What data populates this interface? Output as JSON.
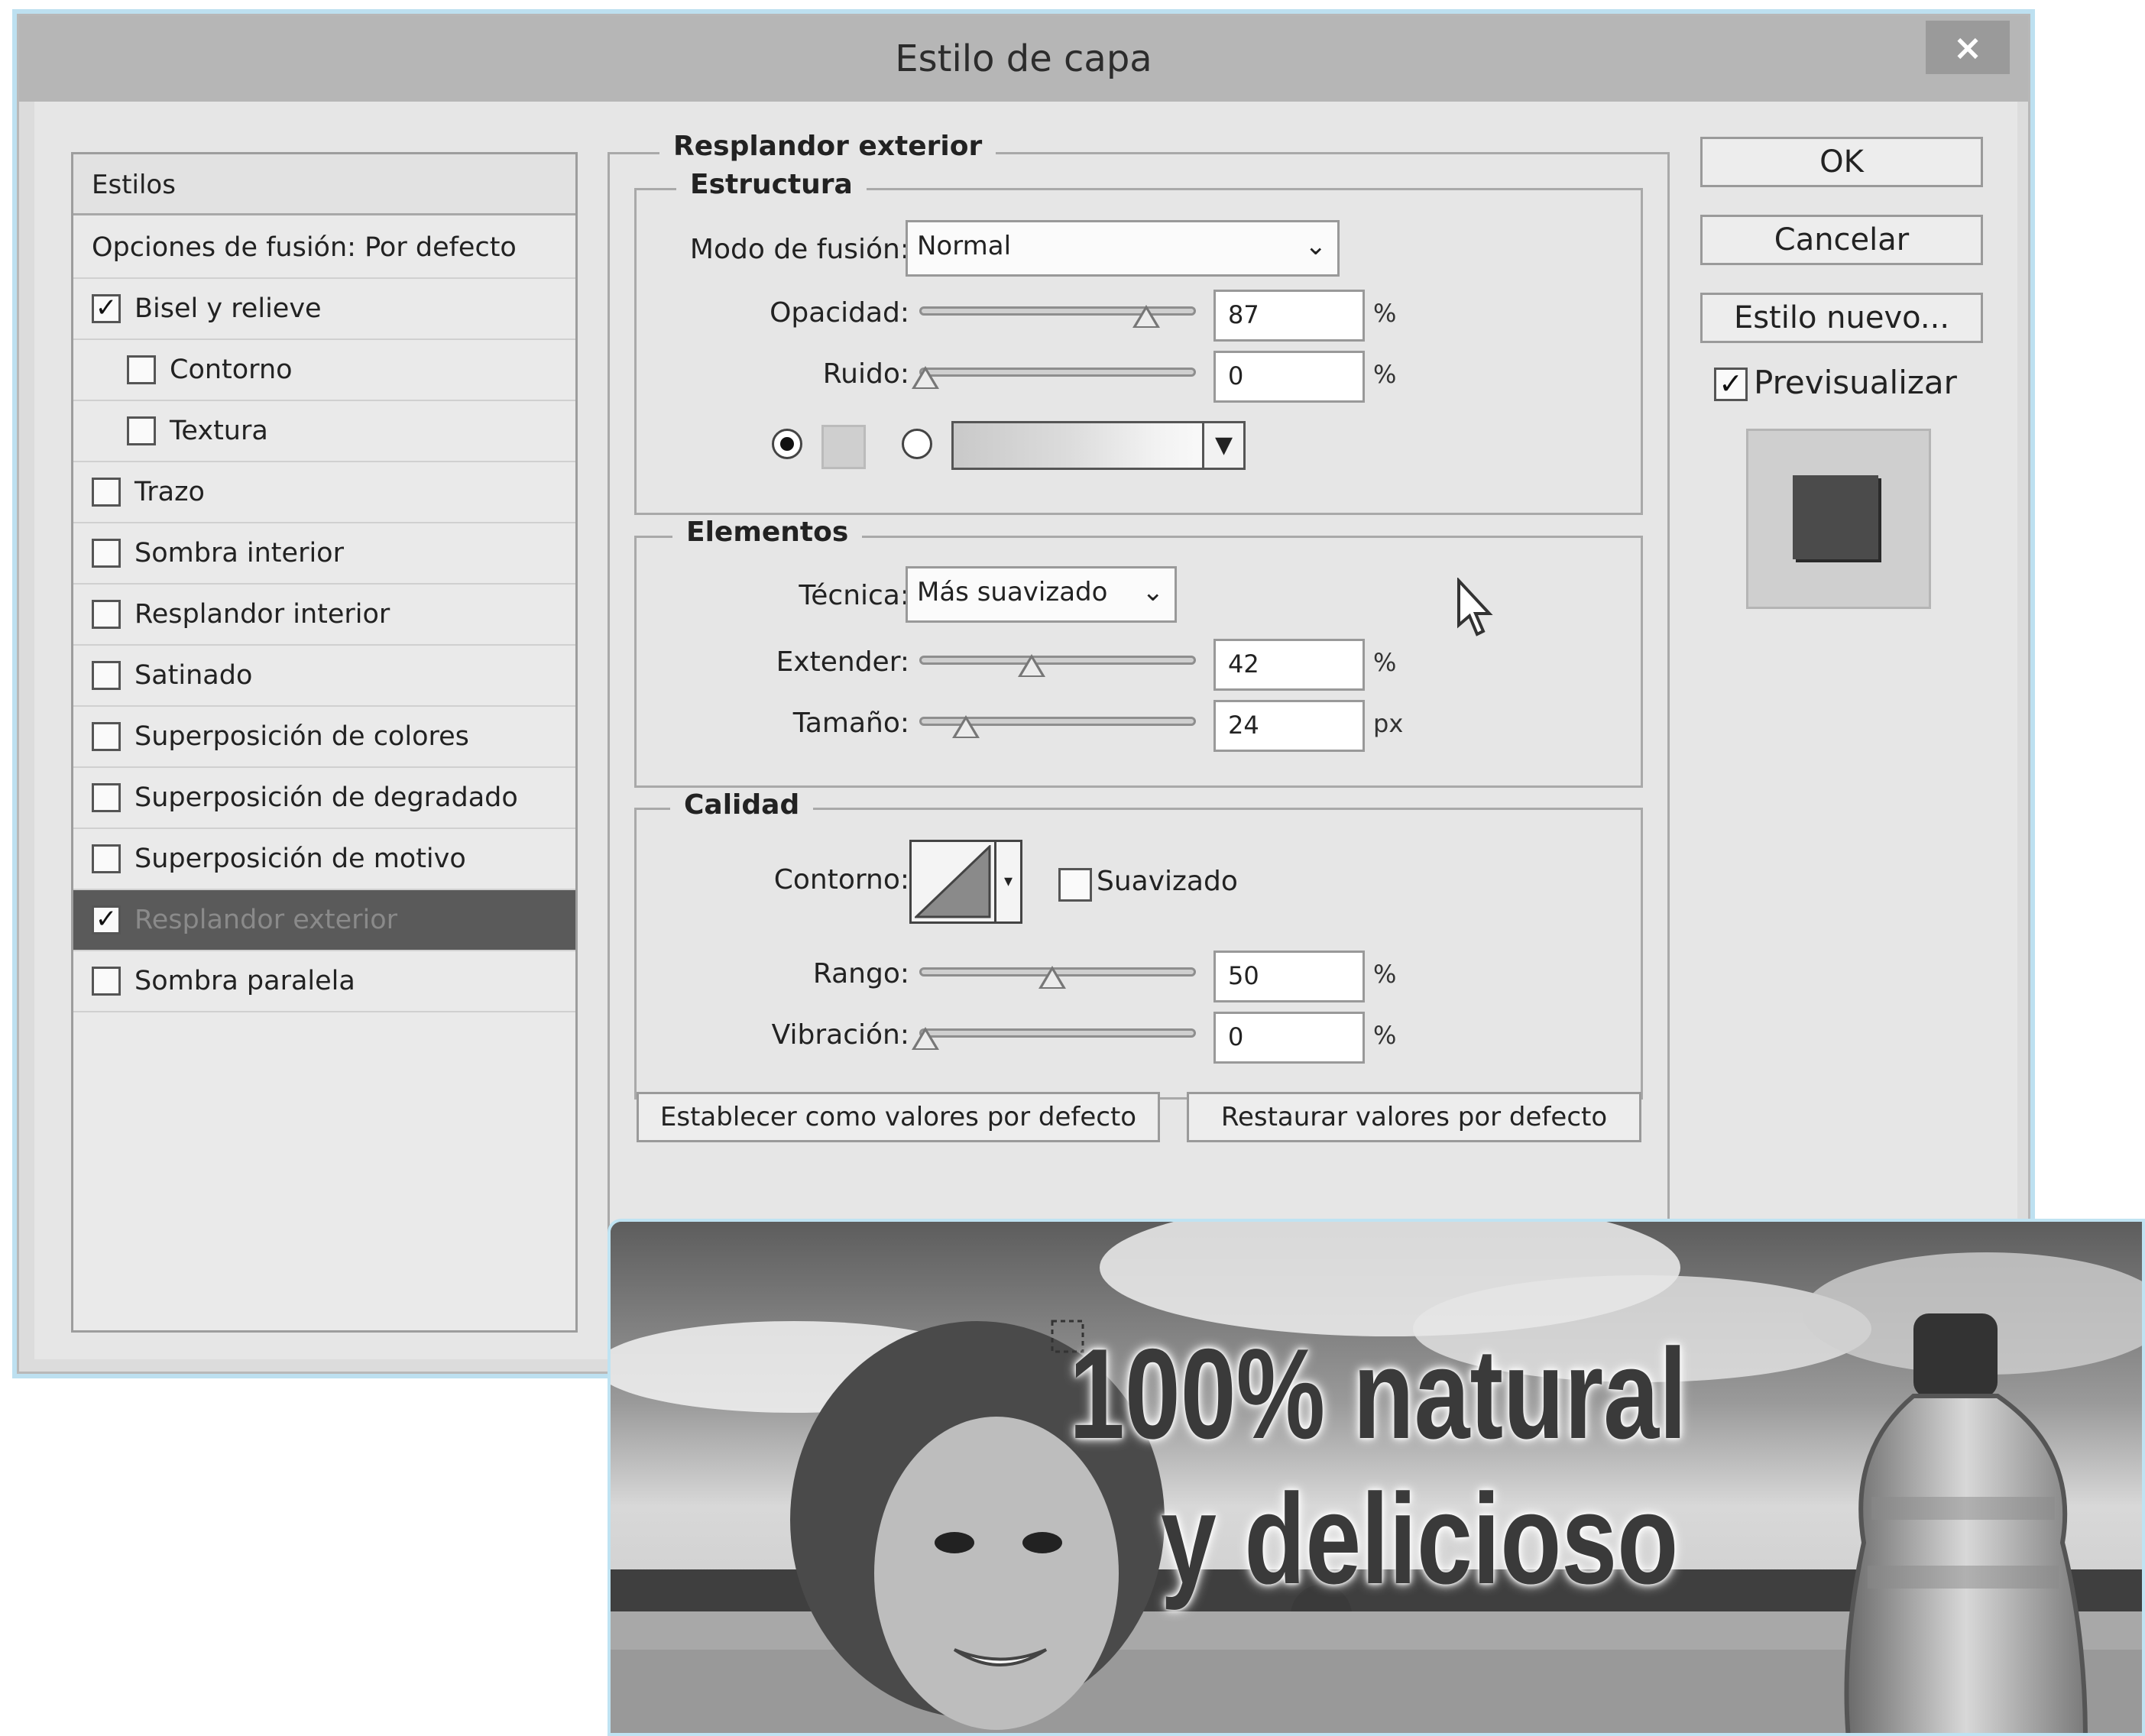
{
  "dialog": {
    "title": "Estilo de capa",
    "close_label": "×"
  },
  "styles_panel": {
    "header": "Estilos",
    "items": [
      {
        "label": "Opciones de fusión: Por defecto",
        "has_checkbox": false,
        "checked": false,
        "selected": false
      },
      {
        "label": "Bisel y relieve",
        "has_checkbox": true,
        "checked": true,
        "selected": false
      },
      {
        "label": "Contorno",
        "has_checkbox": true,
        "checked": false,
        "selected": false
      },
      {
        "label": "Textura",
        "has_checkbox": true,
        "checked": false,
        "selected": false
      },
      {
        "label": "Trazo",
        "has_checkbox": true,
        "checked": false,
        "selected": false
      },
      {
        "label": "Sombra interior",
        "has_checkbox": true,
        "checked": false,
        "selected": false
      },
      {
        "label": "Resplandor interior",
        "has_checkbox": true,
        "checked": false,
        "selected": false
      },
      {
        "label": "Satinado",
        "has_checkbox": true,
        "checked": false,
        "selected": false
      },
      {
        "label": "Superposición de colores",
        "has_checkbox": true,
        "checked": false,
        "selected": false
      },
      {
        "label": "Superposición de degradado",
        "has_checkbox": true,
        "checked": false,
        "selected": false
      },
      {
        "label": "Superposición de motivo",
        "has_checkbox": true,
        "checked": false,
        "selected": false
      },
      {
        "label": "Resplandor exterior",
        "has_checkbox": true,
        "checked": true,
        "selected": true
      },
      {
        "label": "Sombra paralela",
        "has_checkbox": true,
        "checked": false,
        "selected": false
      }
    ]
  },
  "outer_glow": {
    "title": "Resplandor exterior",
    "structure": {
      "title": "Estructura",
      "blend_mode_label": "Modo de fusión:",
      "blend_mode_value": "Normal",
      "opacity_label": "Opacidad:",
      "opacity_value": "87",
      "opacity_unit": "%",
      "opacity_level": 0.87,
      "noise_label": "Ruido:",
      "noise_value": "0",
      "noise_unit": "%",
      "noise_level": 0.0
    },
    "elements": {
      "title": "Elementos",
      "technique_label": "Técnica:",
      "technique_value": "Más suavizado",
      "spread_label": "Extender:",
      "spread_value": "42",
      "spread_unit": "%",
      "spread_level": 0.42,
      "size_label": "Tamaño:",
      "size_value": "24",
      "size_unit": "px",
      "size_level": 0.16
    },
    "quality": {
      "title": "Calidad",
      "contour_label": "Contorno:",
      "antialias_label": "Suavizado",
      "range_label": "Rango:",
      "range_value": "50",
      "range_unit": "%",
      "range_level": 0.5,
      "jitter_label": "Vibración:",
      "jitter_value": "0",
      "jitter_unit": "%",
      "jitter_level": 0.0
    },
    "make_default_label": "Establecer como valores por defecto",
    "reset_default_label": "Restaurar valores por defecto"
  },
  "actions": {
    "ok_label": "OK",
    "cancel_label": "Cancelar",
    "new_style_label": "Estilo nuevo...",
    "preview_label": "Previsualizar",
    "preview_checked": true
  },
  "photo": {
    "headline_line1": "100% natural",
    "headline_line2": "y delicioso"
  }
}
